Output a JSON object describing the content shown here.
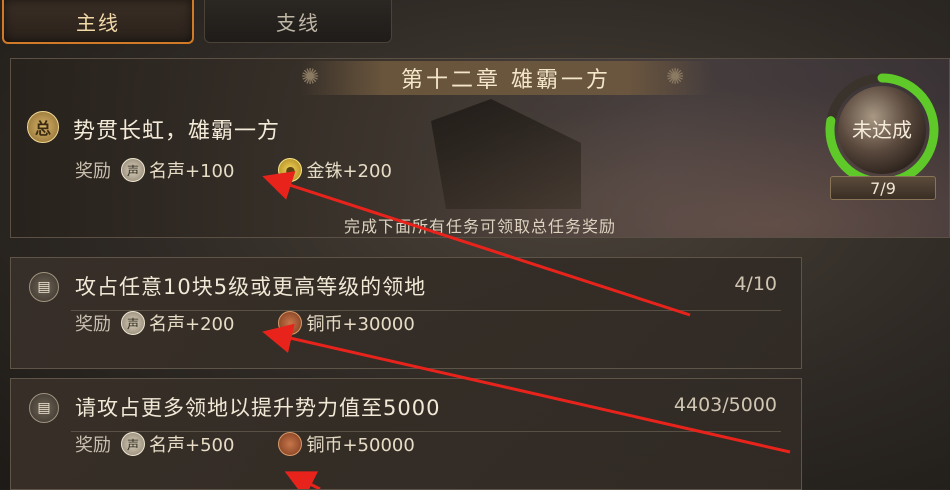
{
  "tabs": {
    "main_label": "主线",
    "side_label": "支线"
  },
  "chapter": {
    "title": "第十二章 雄霸一方",
    "badge": "总",
    "main_task": "势贯长虹，雄霸一方",
    "reward_label": "奖励",
    "rewards": [
      {
        "icon_text": "声",
        "icon": "fame-icon",
        "text": "名声+100"
      },
      {
        "icon_text": "铢",
        "icon": "gold-coin-icon",
        "text": "金铢+200"
      }
    ],
    "note": "完成下面所有任务可领取总任务奖励",
    "progress": {
      "status": "未达成",
      "count": "7/9",
      "fraction": 0.778
    }
  },
  "tasks": [
    {
      "title": "攻占任意10块5级或更高等级的领地",
      "count": "4/10",
      "reward_label": "奖励",
      "rewards": [
        {
          "icon_text": "声",
          "icon": "fame-icon",
          "text": "名声+200"
        },
        {
          "icon_text": "",
          "icon": "copper-coin-icon",
          "text": "铜币+30000"
        }
      ]
    },
    {
      "title": "请攻占更多领地以提升势力值至5000",
      "count": "4403/5000",
      "reward_label": "奖励",
      "rewards": [
        {
          "icon_text": "声",
          "icon": "fame-icon",
          "text": "名声+500"
        },
        {
          "icon_text": "",
          "icon": "copper-coin-icon",
          "text": "铜币+50000"
        }
      ]
    }
  ],
  "colors": {
    "accent_orange": "#d07a28",
    "progress_green": "#5fc92a",
    "arrow_red": "#e8231c"
  }
}
